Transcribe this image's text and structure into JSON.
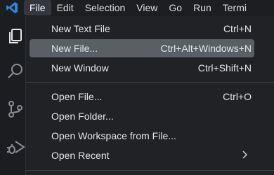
{
  "menubar": {
    "items": [
      "File",
      "Edit",
      "Selection",
      "View",
      "Go",
      "Run",
      "Termi"
    ]
  },
  "activitybar": {
    "icons": [
      "explorer-icon",
      "search-icon",
      "source-control-icon",
      "run-debug-icon"
    ]
  },
  "file_menu": {
    "group1": [
      {
        "label": "New Text File",
        "shortcut": "Ctrl+N"
      },
      {
        "label": "New File...",
        "shortcut": "Ctrl+Alt+Windows+N"
      },
      {
        "label": "New Window",
        "shortcut": "Ctrl+Shift+N"
      }
    ],
    "group2": [
      {
        "label": "Open File...",
        "shortcut": "Ctrl+O"
      },
      {
        "label": "Open Folder...",
        "shortcut": ""
      },
      {
        "label": "Open Workspace from File...",
        "shortcut": ""
      },
      {
        "label": "Open Recent",
        "shortcut": ""
      }
    ]
  },
  "colors": {
    "accent_blue": "#2f86d6",
    "highlight": "#5a5f67",
    "menu_bg": "#202226"
  }
}
